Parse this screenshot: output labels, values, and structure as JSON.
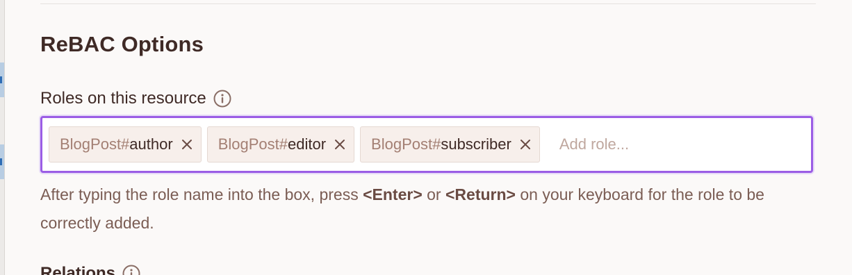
{
  "section": {
    "title": "ReBAC Options"
  },
  "roles_field": {
    "label": "Roles on this resource",
    "info_icon": "info-circle-icon",
    "tags": [
      {
        "prefix": "BlogPost#",
        "role": "author"
      },
      {
        "prefix": "BlogPost#",
        "role": "editor"
      },
      {
        "prefix": "BlogPost#",
        "role": "subscriber"
      }
    ],
    "remove_icon": "close-icon",
    "input_placeholder": "Add role...",
    "input_value": ""
  },
  "help": {
    "part1": "After typing the role name into the box, press ",
    "key_enter": "<Enter>",
    "part2": " or ",
    "key_return": "<Return>",
    "part3": " on your keyboard for the role to be correctly added."
  },
  "next_section": {
    "label": "Relations",
    "info_icon": "info-circle-icon"
  },
  "colors": {
    "focus_border": "#9b5de5",
    "heading_text": "#3f2a26",
    "muted_text": "#7b5d54",
    "tag_background": "#f7efeb"
  }
}
